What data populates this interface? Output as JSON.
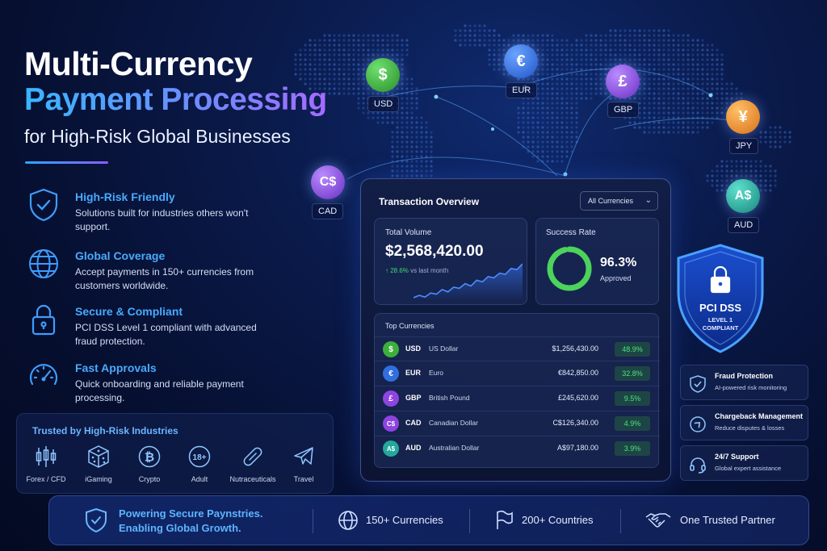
{
  "headline": {
    "line1": "Multi-Currency",
    "line2": "Payment Processing",
    "line3": "for High-Risk Global Businesses"
  },
  "features": [
    {
      "icon": "shield-check-icon",
      "title": "High-Risk Friendly",
      "desc": "Solutions built for industries others won't support."
    },
    {
      "icon": "globe-icon",
      "title": "Global Coverage",
      "desc": "Accept payments in 150+ currencies from customers worldwide."
    },
    {
      "icon": "lock-icon",
      "title": "Secure & Compliant",
      "desc": "PCI DSS Level 1 compliant with advanced fraud protection."
    },
    {
      "icon": "speedometer-icon",
      "title": "Fast Approvals",
      "desc": "Quick onboarding and reliable payment processing."
    }
  ],
  "industries": {
    "title": "Trusted by High-Risk Industries",
    "items": [
      {
        "icon": "candlestick-icon",
        "label": "Forex / CFD"
      },
      {
        "icon": "dice-icon",
        "label": "iGaming"
      },
      {
        "icon": "bitcoin-icon",
        "label": "Crypto"
      },
      {
        "icon": "18-plus-icon",
        "label": "Adult",
        "glyph": "18+"
      },
      {
        "icon": "capsule-icon",
        "label": "Nutraceuticals"
      },
      {
        "icon": "airplane-icon",
        "label": "Travel"
      }
    ]
  },
  "coins": [
    {
      "code": "USD",
      "symbol": "$",
      "color": "#3cae3c"
    },
    {
      "code": "EUR",
      "symbol": "€",
      "color": "#2f6fe0"
    },
    {
      "code": "GBP",
      "symbol": "£",
      "color": "#8e44e0"
    },
    {
      "code": "JPY",
      "symbol": "¥",
      "color": "#f0962a"
    },
    {
      "code": "CAD",
      "symbol": "C$",
      "color": "#8e44e0"
    },
    {
      "code": "AUD",
      "symbol": "A$",
      "color": "#23a89b"
    }
  ],
  "dashboard": {
    "title": "Transaction Overview",
    "filter": "All Currencies",
    "volume": {
      "label": "Total Volume",
      "value": "$2,568,420.00",
      "change": "↑ 28.6%",
      "change_suffix": "vs last month",
      "trend": [
        10,
        14,
        11,
        18,
        16,
        24,
        20,
        28,
        26,
        34,
        30,
        40,
        37,
        46,
        44,
        52,
        50,
        60,
        58,
        68
      ]
    },
    "success": {
      "label": "Success Rate",
      "value": "96.3%",
      "sub": "Approved",
      "rate": 0.963
    },
    "top": {
      "label": "Top Currencies",
      "rows": [
        {
          "symbol": "$",
          "code": "USD",
          "name": "US Dollar",
          "amount": "$1,256,430.00",
          "pct": "48.9%",
          "color": "#3cae3c"
        },
        {
          "symbol": "€",
          "code": "EUR",
          "name": "Euro",
          "amount": "€842,850.00",
          "pct": "32.8%",
          "color": "#2f6fe0"
        },
        {
          "symbol": "£",
          "code": "GBP",
          "name": "British Pound",
          "amount": "£245,620.00",
          "pct": "9.5%",
          "color": "#8e44e0"
        },
        {
          "symbol": "C$",
          "code": "CAD",
          "name": "Canadian Dollar",
          "amount": "C$126,340.00",
          "pct": "4.9%",
          "color": "#8e44e0"
        },
        {
          "symbol": "A$",
          "code": "AUD",
          "name": "Australian Dollar",
          "amount": "A$97,180.00",
          "pct": "3.9%",
          "color": "#23a89b"
        }
      ]
    }
  },
  "pci": {
    "title": "PCI DSS",
    "level": "LEVEL 1",
    "status": "COMPLIANT"
  },
  "side_features": [
    {
      "icon": "shield-check-icon",
      "title": "Fraud Protection",
      "desc": "AI-powered risk monitoring"
    },
    {
      "icon": "refresh-shield-icon",
      "title": "Chargeback Management",
      "desc": "Reduce disputes & losses"
    },
    {
      "icon": "headset-icon",
      "title": "24/7 Support",
      "desc": "Global expert assistance"
    }
  ],
  "bottom": {
    "tagline1": "Powering Secure Paynstries.",
    "tagline2": "Enabling Global Growth.",
    "stats": [
      {
        "icon": "globe-icon",
        "label": "150+ Currencies"
      },
      {
        "icon": "flag-icon",
        "label": "200+ Countries"
      },
      {
        "icon": "handshake-icon",
        "label": "One Trusted Partner"
      }
    ]
  },
  "colors": {
    "accent": "#49aaff",
    "success": "#3ddc6f",
    "background": "#0a1a4a"
  }
}
